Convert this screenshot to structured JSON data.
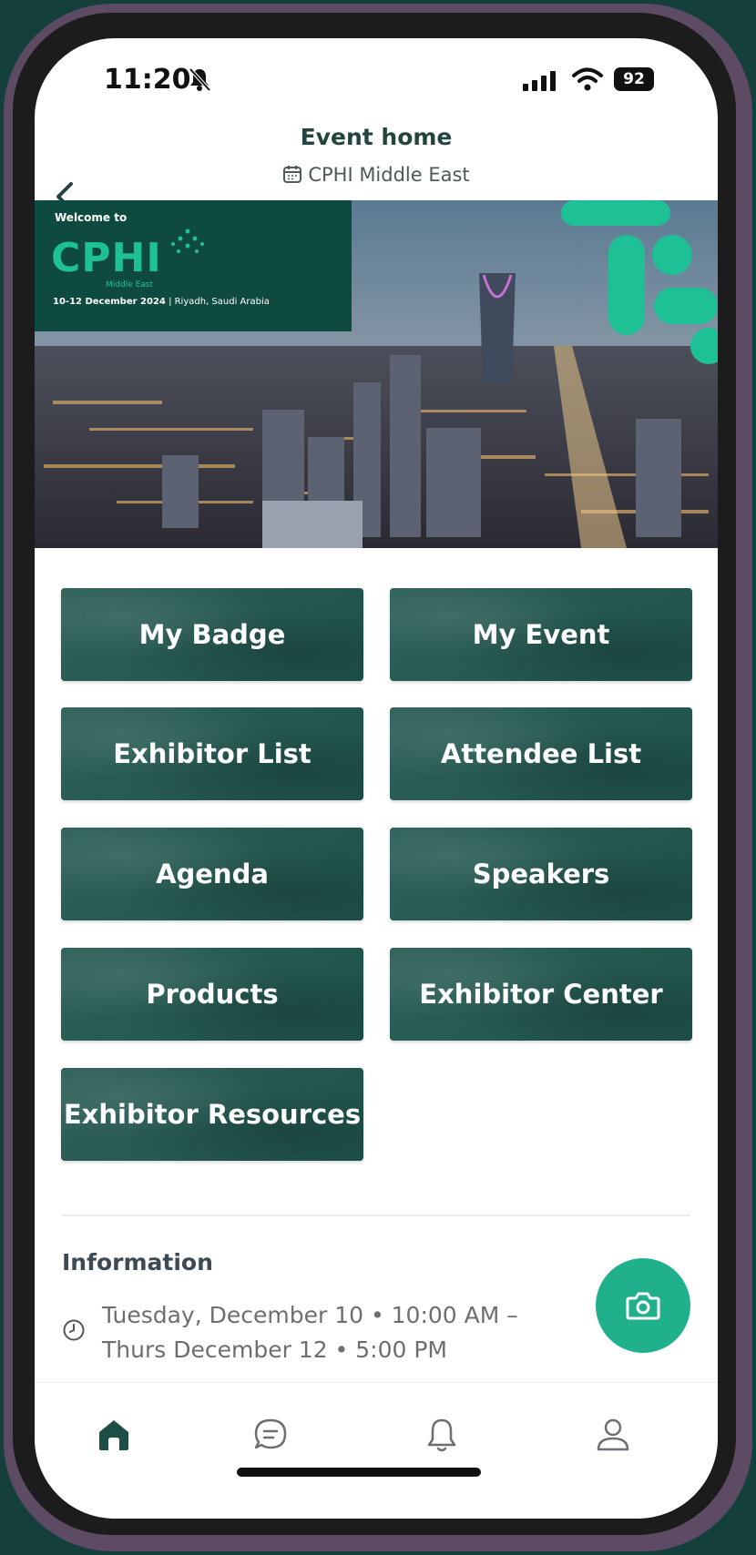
{
  "status_bar": {
    "time": "11:20",
    "battery": "92"
  },
  "header": {
    "title": "Event home",
    "subtitle": "CPHI Middle East"
  },
  "banner": {
    "welcome": "Welcome to",
    "brand": "CPHI",
    "brand_sub": "Middle East",
    "dates": "10-12 December 2024",
    "location": "| Riyadh, Saudi Arabia"
  },
  "tiles": [
    {
      "label": "My Badge"
    },
    {
      "label": "My Event"
    },
    {
      "label": "Exhibitor List"
    },
    {
      "label": "Attendee List"
    },
    {
      "label": "Agenda"
    },
    {
      "label": "Speakers"
    },
    {
      "label": "Products"
    },
    {
      "label": "Exhibitor Center"
    },
    {
      "label": "Exhibitor Resources"
    }
  ],
  "information": {
    "title": "Information",
    "datetime": "Tuesday, December 10 • 10:00 AM – Thurs December 12 • 5:00 PM"
  },
  "bottom_nav": {
    "items": [
      "home-icon",
      "chat-icon",
      "bell-icon",
      "profile-icon"
    ],
    "active": "home"
  },
  "colors": {
    "accent": "#20b08c",
    "tile": "#215950",
    "active_nav": "#1d4f47"
  }
}
